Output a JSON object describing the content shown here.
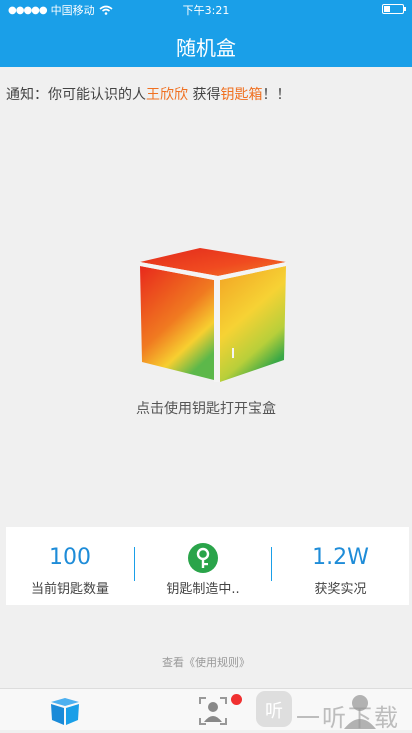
{
  "status_bar": {
    "carrier": "中国移动",
    "time": "下午3:21"
  },
  "header": {
    "title": "随机盒"
  },
  "notice": {
    "prefix": "通知：你可能认识的人",
    "name": "王欣欣",
    "middle": " 获得",
    "item": "钥匙箱",
    "suffix": "！！"
  },
  "box": {
    "hint": "点击使用钥匙打开宝盒"
  },
  "stats": {
    "keys_value": "100",
    "keys_label": "当前钥匙数量",
    "making_label": "钥匙制造中..",
    "awards_value": "1.2W",
    "awards_label": "获奖实况"
  },
  "rules_link": "查看《使用规则》",
  "watermark": "一听下载",
  "colors": {
    "header": "#1a9fe8",
    "accent_orange": "#f07020",
    "stat_blue": "#1e8cd8",
    "key_green": "#2aa44a",
    "badge_red": "#f03030"
  },
  "icons": [
    "wifi-icon",
    "battery-icon",
    "cube-tab-icon",
    "friends-tab-icon",
    "key-icon",
    "profile-tab-icon"
  ]
}
